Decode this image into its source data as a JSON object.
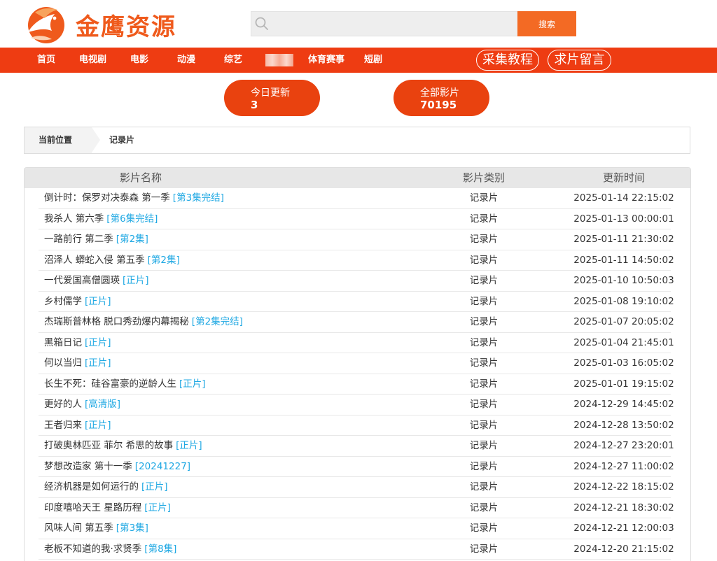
{
  "brand": {
    "name": "金鹰资源",
    "color": "#ef5a1c"
  },
  "search": {
    "placeholder": "",
    "button_label": "搜索",
    "icon": "search-icon"
  },
  "nav": {
    "items": [
      "首页",
      "电视剧",
      "电影",
      "动漫",
      "综艺",
      "体育赛事",
      "短剧"
    ],
    "pills": [
      "采集教程",
      "求片留言"
    ],
    "color": "#ee3c12"
  },
  "stats": [
    {
      "label": "今日更新",
      "value": "3"
    },
    {
      "label": "全部影片",
      "value": "70195"
    }
  ],
  "breadcrumb": {
    "head": "当前位置",
    "current": "记录片"
  },
  "table": {
    "headers": [
      "影片名称",
      "影片类别",
      "更新时间"
    ],
    "rows": [
      {
        "name": "倒计时：保罗对决泰森 第一季",
        "tag": "[第3集完结]",
        "type": "记录片",
        "time": "2025-01-14 22:15:02"
      },
      {
        "name": "我杀人 第六季",
        "tag": "[第6集完结]",
        "type": "记录片",
        "time": "2025-01-13 00:00:01"
      },
      {
        "name": "一路前行 第二季",
        "tag": "[第2集]",
        "type": "记录片",
        "time": "2025-01-11 21:30:02"
      },
      {
        "name": "沼泽人 蟒蛇入侵 第五季",
        "tag": "[第2集]",
        "type": "记录片",
        "time": "2025-01-11 14:50:02"
      },
      {
        "name": "一代爱国高僧圆瑛",
        "tag": "[正片]",
        "type": "记录片",
        "time": "2025-01-10 10:50:03"
      },
      {
        "name": "乡村儒学",
        "tag": "[正片]",
        "type": "记录片",
        "time": "2025-01-08 19:10:02"
      },
      {
        "name": "杰瑞斯普林格 脱口秀劲爆内幕揭秘",
        "tag": "[第2集完结]",
        "type": "记录片",
        "time": "2025-01-07 20:05:02"
      },
      {
        "name": "黑箱日记",
        "tag": "[正片]",
        "type": "记录片",
        "time": "2025-01-04 21:45:01"
      },
      {
        "name": "何以当归",
        "tag": "[正片]",
        "type": "记录片",
        "time": "2025-01-03 16:05:02"
      },
      {
        "name": "长生不死：硅谷富豪的逆龄人生",
        "tag": "[正片]",
        "type": "记录片",
        "time": "2025-01-01 19:15:02"
      },
      {
        "name": "更好的人",
        "tag": "[高清版]",
        "type": "记录片",
        "time": "2024-12-29 14:45:02"
      },
      {
        "name": "王者归来",
        "tag": "[正片]",
        "type": "记录片",
        "time": "2024-12-28 13:50:02"
      },
      {
        "name": "打破奥林匹亚 菲尔 希思的故事",
        "tag": "[正片]",
        "type": "记录片",
        "time": "2024-12-27 23:20:01"
      },
      {
        "name": "梦想改造家 第十一季",
        "tag": "[20241227]",
        "type": "记录片",
        "time": "2024-12-27 11:00:02"
      },
      {
        "name": "经济机器是如何运行的",
        "tag": "[正片]",
        "type": "记录片",
        "time": "2024-12-22 18:15:02"
      },
      {
        "name": "印度嘻哈天王 星路历程",
        "tag": "[正片]",
        "type": "记录片",
        "time": "2024-12-21 18:30:02"
      },
      {
        "name": "风味人间 第五季",
        "tag": "[第3集]",
        "type": "记录片",
        "time": "2024-12-21 12:00:03"
      },
      {
        "name": "老板不知道的我·求贤季",
        "tag": "[第8集]",
        "type": "记录片",
        "time": "2024-12-20 21:15:02"
      }
    ]
  }
}
